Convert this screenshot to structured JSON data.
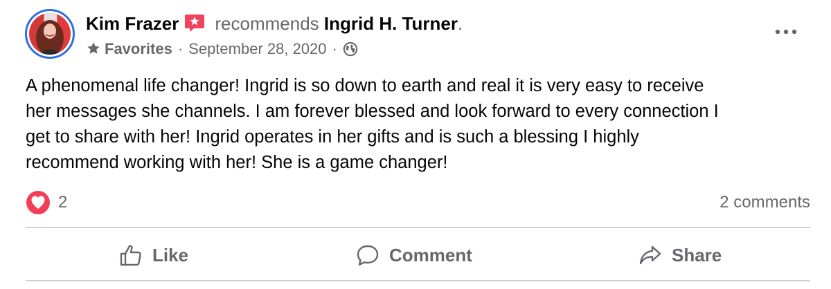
{
  "post": {
    "author": "Kim Frazer",
    "verb": "recommends",
    "target": "Ingrid H. Turner",
    "period": ".",
    "audience": "Favorites",
    "separator": "·",
    "date": "September 28, 2020",
    "icons": {
      "avatar": "profile-photo",
      "badge": "recommendation-star-badge",
      "audience": "star-icon",
      "privacy": "globe-icon",
      "more": "more-horizontal-icon"
    },
    "text": "A phenomenal life changer! Ingrid is so down to earth and real it is very easy to receive\nher messages she channels. I am forever blessed and look forward to every connection I\nget to share with her! Ingrid operates in her gifts and is such a blessing I highly\nrecommend working with her! She is a game changer!"
  },
  "reactions": {
    "icon": "love-reaction-icon",
    "count": "2",
    "comments": "2 comments"
  },
  "actions": {
    "like": "Like",
    "comment": "Comment",
    "share": "Share"
  },
  "colors": {
    "badge": "#f0445c",
    "love": "#f33e58",
    "avatar_ring": "#2d6fe0",
    "muted": "#65676b",
    "divider": "#ced0d4"
  }
}
